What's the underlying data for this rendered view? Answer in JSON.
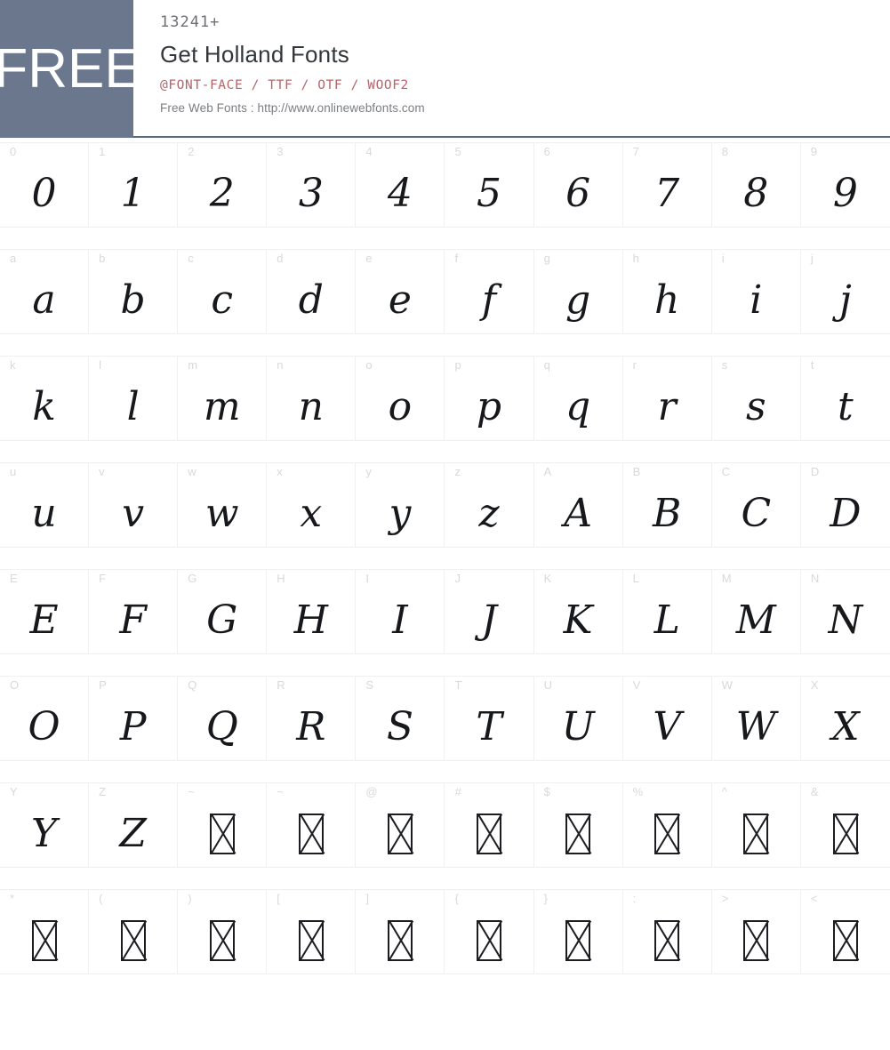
{
  "header": {
    "badge_label": "FREE",
    "font_count": "13241+",
    "title": "Get Holland Fonts",
    "formats": "@FONT-FACE / TTF / OTF / WOOF2",
    "site_line": "Free Web Fonts : http://www.onlinewebfonts.com",
    "badge_color": "#6b778d",
    "formats_color": "#b4656a",
    "rule_color": "#5c6a80"
  },
  "grid": {
    "columns": 10,
    "rows": [
      {
        "cells": [
          {
            "label": "0",
            "glyph": "0",
            "missing": false
          },
          {
            "label": "1",
            "glyph": "1",
            "missing": false
          },
          {
            "label": "2",
            "glyph": "2",
            "missing": false
          },
          {
            "label": "3",
            "glyph": "3",
            "missing": false
          },
          {
            "label": "4",
            "glyph": "4",
            "missing": false
          },
          {
            "label": "5",
            "glyph": "5",
            "missing": false
          },
          {
            "label": "6",
            "glyph": "6",
            "missing": false
          },
          {
            "label": "7",
            "glyph": "7",
            "missing": false
          },
          {
            "label": "8",
            "glyph": "8",
            "missing": false
          },
          {
            "label": "9",
            "glyph": "9",
            "missing": false
          }
        ]
      },
      {
        "cells": [
          {
            "label": "a",
            "glyph": "a",
            "missing": false
          },
          {
            "label": "b",
            "glyph": "b",
            "missing": false
          },
          {
            "label": "c",
            "glyph": "c",
            "missing": false
          },
          {
            "label": "d",
            "glyph": "d",
            "missing": false
          },
          {
            "label": "e",
            "glyph": "e",
            "missing": false
          },
          {
            "label": "f",
            "glyph": "f",
            "missing": false
          },
          {
            "label": "g",
            "glyph": "g",
            "missing": false
          },
          {
            "label": "h",
            "glyph": "h",
            "missing": false
          },
          {
            "label": "i",
            "glyph": "i",
            "missing": false
          },
          {
            "label": "j",
            "glyph": "j",
            "missing": false
          }
        ]
      },
      {
        "cells": [
          {
            "label": "k",
            "glyph": "k",
            "missing": false
          },
          {
            "label": "l",
            "glyph": "l",
            "missing": false
          },
          {
            "label": "m",
            "glyph": "m",
            "missing": false
          },
          {
            "label": "n",
            "glyph": "n",
            "missing": false
          },
          {
            "label": "o",
            "glyph": "o",
            "missing": false
          },
          {
            "label": "p",
            "glyph": "p",
            "missing": false
          },
          {
            "label": "q",
            "glyph": "q",
            "missing": false
          },
          {
            "label": "r",
            "glyph": "r",
            "missing": false
          },
          {
            "label": "s",
            "glyph": "s",
            "missing": false
          },
          {
            "label": "t",
            "glyph": "t",
            "missing": false
          }
        ]
      },
      {
        "cells": [
          {
            "label": "u",
            "glyph": "u",
            "missing": false
          },
          {
            "label": "v",
            "glyph": "v",
            "missing": false
          },
          {
            "label": "w",
            "glyph": "w",
            "missing": false
          },
          {
            "label": "x",
            "glyph": "x",
            "missing": false
          },
          {
            "label": "y",
            "glyph": "y",
            "missing": false
          },
          {
            "label": "z",
            "glyph": "z",
            "missing": false
          },
          {
            "label": "A",
            "glyph": "A",
            "missing": false
          },
          {
            "label": "B",
            "glyph": "B",
            "missing": false
          },
          {
            "label": "C",
            "glyph": "C",
            "missing": false
          },
          {
            "label": "D",
            "glyph": "D",
            "missing": false
          }
        ]
      },
      {
        "cells": [
          {
            "label": "E",
            "glyph": "E",
            "missing": false
          },
          {
            "label": "F",
            "glyph": "F",
            "missing": false
          },
          {
            "label": "G",
            "glyph": "G",
            "missing": false
          },
          {
            "label": "H",
            "glyph": "H",
            "missing": false
          },
          {
            "label": "I",
            "glyph": "I",
            "missing": false
          },
          {
            "label": "J",
            "glyph": "J",
            "missing": false
          },
          {
            "label": "K",
            "glyph": "K",
            "missing": false
          },
          {
            "label": "L",
            "glyph": "L",
            "missing": false
          },
          {
            "label": "M",
            "glyph": "M",
            "missing": false
          },
          {
            "label": "N",
            "glyph": "N",
            "missing": false
          }
        ]
      },
      {
        "cells": [
          {
            "label": "O",
            "glyph": "O",
            "missing": false
          },
          {
            "label": "P",
            "glyph": "P",
            "missing": false
          },
          {
            "label": "Q",
            "glyph": "Q",
            "missing": false
          },
          {
            "label": "R",
            "glyph": "R",
            "missing": false
          },
          {
            "label": "S",
            "glyph": "S",
            "missing": false
          },
          {
            "label": "T",
            "glyph": "T",
            "missing": false
          },
          {
            "label": "U",
            "glyph": "U",
            "missing": false
          },
          {
            "label": "V",
            "glyph": "V",
            "missing": false
          },
          {
            "label": "W",
            "glyph": "W",
            "missing": false
          },
          {
            "label": "X",
            "glyph": "X",
            "missing": false
          }
        ]
      },
      {
        "cells": [
          {
            "label": "Y",
            "glyph": "Y",
            "missing": false
          },
          {
            "label": "Z",
            "glyph": "Z",
            "missing": false
          },
          {
            "label": "~",
            "glyph": "",
            "missing": true
          },
          {
            "label": "~",
            "glyph": "",
            "missing": true
          },
          {
            "label": "@",
            "glyph": "",
            "missing": true
          },
          {
            "label": "#",
            "glyph": "",
            "missing": true
          },
          {
            "label": "$",
            "glyph": "",
            "missing": true
          },
          {
            "label": "%",
            "glyph": "",
            "missing": true
          },
          {
            "label": "^",
            "glyph": "",
            "missing": true
          },
          {
            "label": "&",
            "glyph": "",
            "missing": true
          }
        ]
      },
      {
        "cells": [
          {
            "label": "*",
            "glyph": "",
            "missing": true
          },
          {
            "label": "(",
            "glyph": "",
            "missing": true
          },
          {
            "label": ")",
            "glyph": "",
            "missing": true
          },
          {
            "label": "[",
            "glyph": "",
            "missing": true
          },
          {
            "label": "]",
            "glyph": "",
            "missing": true
          },
          {
            "label": "{",
            "glyph": "",
            "missing": true
          },
          {
            "label": "}",
            "glyph": "",
            "missing": true
          },
          {
            "label": ":",
            "glyph": "",
            "missing": true
          },
          {
            "label": ">",
            "glyph": "",
            "missing": true
          },
          {
            "label": "<",
            "glyph": "",
            "missing": true
          }
        ]
      }
    ]
  }
}
